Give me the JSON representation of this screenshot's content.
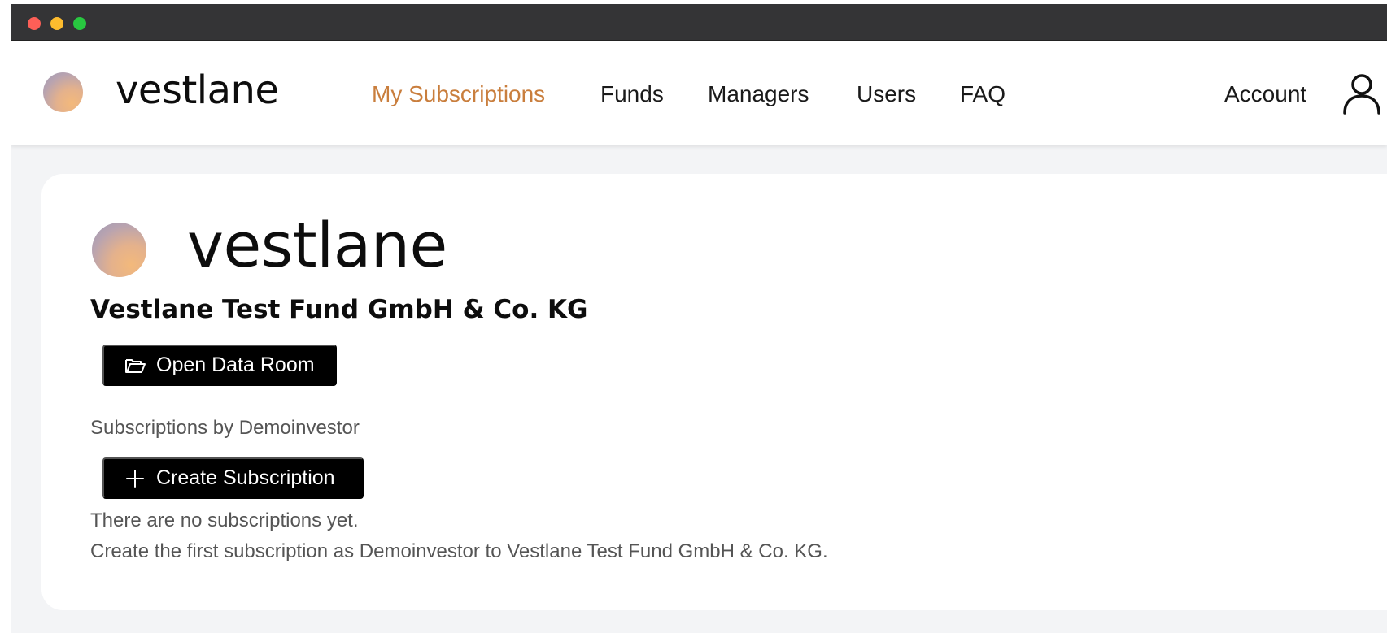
{
  "brand": {
    "name": "vestlane"
  },
  "nav": {
    "links": [
      {
        "label": "My Subscriptions",
        "active": true
      },
      {
        "label": "Funds",
        "active": false
      },
      {
        "label": "Managers",
        "active": false
      },
      {
        "label": "Users",
        "active": false
      },
      {
        "label": "FAQ",
        "active": false
      }
    ],
    "account_label": "Account"
  },
  "fund": {
    "name": "Vestlane Test Fund GmbH & Co. KG",
    "data_room_button": "Open Data Room",
    "subscriptions_label": "Subscriptions by Demoinvestor",
    "create_button": "Create Subscription",
    "empty_message": "There are no subscriptions yet.",
    "empty_hint": "Create the first subscription as Demoinvestor to Vestlane Test Fund GmbH & Co. KG."
  },
  "colors": {
    "accent": "#c97e3d",
    "titlebar": "#343436",
    "button_bg": "#000000",
    "page_bg": "#f3f4f6"
  },
  "icons": {
    "data_room": "folder-open-icon",
    "create": "plus-icon",
    "account": "user-icon"
  }
}
